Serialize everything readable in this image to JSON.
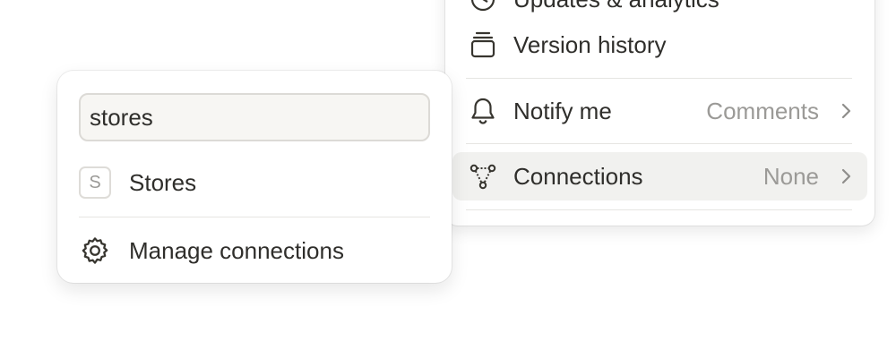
{
  "main_menu": {
    "items": [
      {
        "label": "Updates & analytics",
        "icon": "clock-icon"
      },
      {
        "label": "Version history",
        "icon": "stack-icon"
      },
      {
        "label": "Notify me",
        "value": "Comments",
        "icon": "bell-icon"
      },
      {
        "label": "Connections",
        "value": "None",
        "icon": "connections-icon"
      }
    ]
  },
  "popup": {
    "search": {
      "value": "stores"
    },
    "result": {
      "badge": "S",
      "label": "Stores"
    },
    "manage": {
      "label": "Manage connections",
      "icon": "gear-icon"
    }
  },
  "colors": {
    "hover_row": "#f1f1ef",
    "muted_text": "#9b9a97",
    "text": "#2f2e2b"
  }
}
